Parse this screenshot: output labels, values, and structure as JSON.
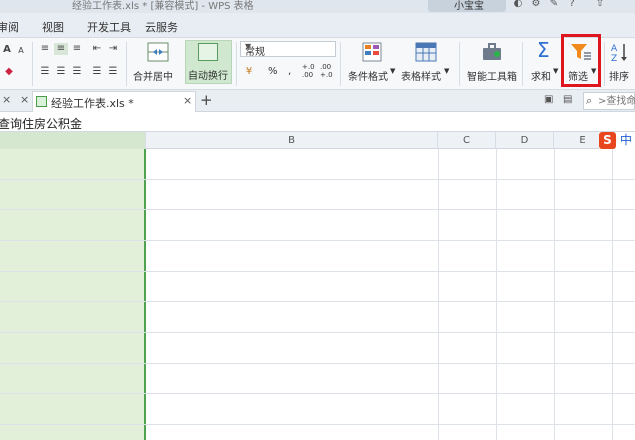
{
  "titlebar": {
    "title": "经验工作表.xls * [兼容模式] - WPS 表格",
    "user": "小宝宝"
  },
  "menu": {
    "items": [
      "审阅",
      "视图",
      "开发工具",
      "云服务"
    ]
  },
  "ribbon": {
    "merge_center": "合并居中",
    "wrap_text": "自动换行",
    "number_format": "常规",
    "percent": "%",
    "thousands": ",",
    "dec_increase": "+.0 .00",
    "dec_decrease": ".00 +.0",
    "conditional_format": "条件格式",
    "table_style": "表格样式",
    "smart_toolbox": "智能工具箱",
    "sum": "求和",
    "filter": "筛选",
    "sort": "排序",
    "font_grow": "A",
    "font_shrink": "A"
  },
  "tabs": {
    "document": "经验工作表.xls *",
    "close": "×",
    "add": "+",
    "search_placeholder": ">查找命令"
  },
  "formula": {
    "content": "查询住房公积金"
  },
  "columns": [
    "B",
    "C",
    "D",
    "E"
  ],
  "ime": {
    "logo": "S",
    "mode": "中"
  },
  "colors": {
    "selection_fill": "#e2f0d9",
    "selection_border": "#4fa24f",
    "highlight": "#e0161e",
    "filter_icon": "#f08a1c",
    "sum_icon": "#2f6fd1"
  }
}
